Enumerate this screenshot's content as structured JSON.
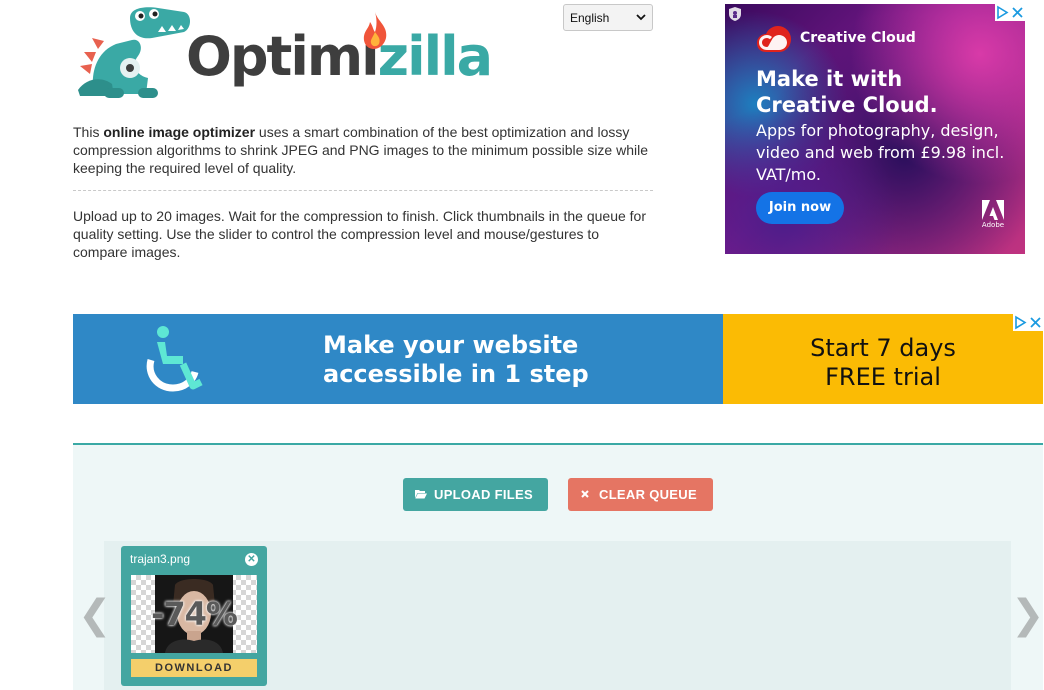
{
  "logo": {
    "word_part1": "Optimi",
    "word_part2": "zilla",
    "colors": {
      "dark": "#3e3e3e",
      "teal": "#3aa9a5",
      "flame": "#f0553a"
    }
  },
  "language_select": {
    "value": "English"
  },
  "intro": {
    "pre": "This ",
    "bold": "online image optimizer",
    "post": " uses a smart combination of the best optimization and lossy compression algorithms to shrink JPEG and PNG images to the minimum possible size while keeping the required level of quality.",
    "instructions": "Upload up to 20 images. Wait for the compression to finish. Click thumbnails in the queue for quality setting. Use the slider to control the compression level and mouse/gestures to compare images."
  },
  "ad_creative_cloud": {
    "brand": "Creative Cloud",
    "headline": "Make it with Creative Cloud.",
    "subtext": "Apps for photography, design, video and web from £9.98 incl. VAT/mo.",
    "cta": "Join now",
    "adobe_label": "Adobe"
  },
  "ad_accessibility": {
    "headline": "Make your website accessible in 1 step",
    "cta_line1": "Start 7 days",
    "cta_line2": "FREE trial",
    "colors": {
      "blue": "#2f88c6",
      "yellow": "#fbbb04"
    }
  },
  "toolbar": {
    "upload_label": "UPLOAD FILES",
    "clear_label": "CLEAR QUEUE",
    "upload_icon": "folder-open-icon",
    "clear_icon": "close-icon"
  },
  "queue": {
    "items": [
      {
        "filename": "trajan3.png",
        "savings": "-74%",
        "download_label": "DOWNLOAD"
      }
    ],
    "prev_arrow": "❮",
    "next_arrow": "❯"
  }
}
